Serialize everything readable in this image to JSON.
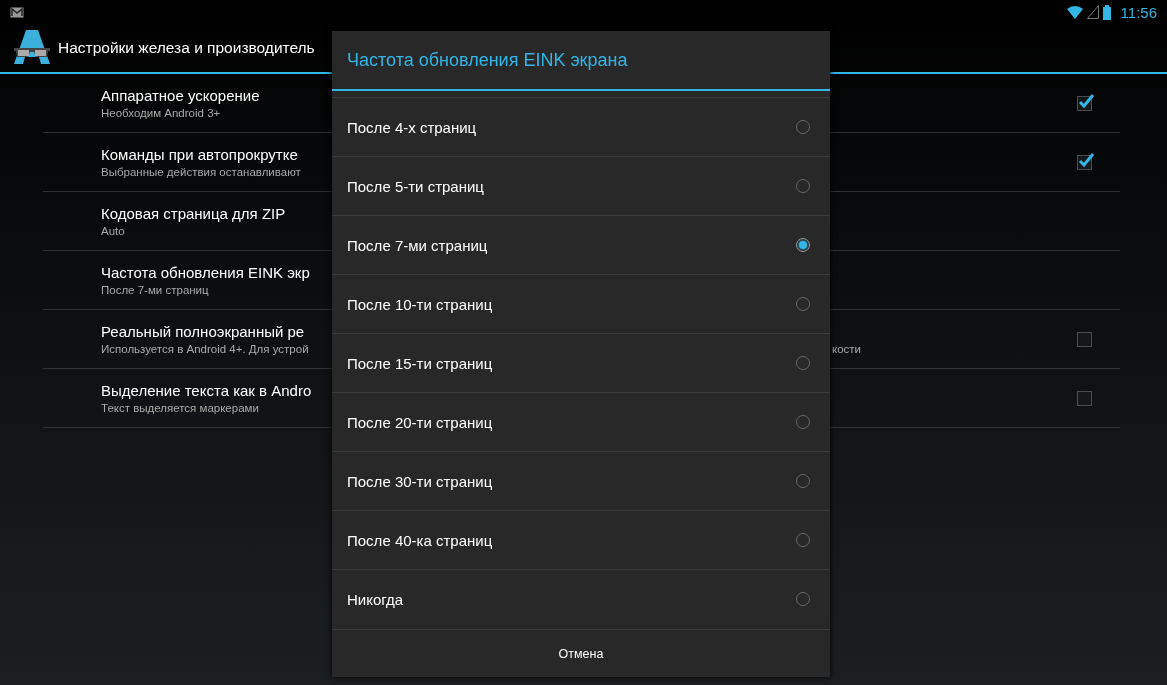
{
  "status_bar": {
    "time": "11:56"
  },
  "action_bar": {
    "title": "Настройки железа и производитель"
  },
  "preferences": [
    {
      "kind": "checkbox",
      "title": "Аппаратное ускорение",
      "summary": "Необходим Android 3+",
      "checked": true
    },
    {
      "kind": "checkbox",
      "title": "Команды при автопрокрутке",
      "summary": "Выбранные действия останавливают",
      "checked": true
    },
    {
      "kind": "plain",
      "title": "Кодовая страница для ZIP",
      "summary": "Auto"
    },
    {
      "kind": "plain",
      "title": "Частота обновления EINK экр",
      "summary": "После 7-ми страниц"
    },
    {
      "kind": "checkbox",
      "title": "Реальный полноэкранный ре",
      "summary": "Используется в Android 4+. Для устрой",
      "summary_end": "кости",
      "checked": false
    },
    {
      "kind": "checkbox",
      "title": "Выделение текста как в Andro",
      "summary": "Текст выделяется маркерами",
      "checked": false
    }
  ],
  "dialog": {
    "title": "Частота обновления EINK экрана",
    "options": [
      {
        "label": "После 4-х страниц",
        "selected": false
      },
      {
        "label": "После 5-ти страниц",
        "selected": false
      },
      {
        "label": "После 7-ми страниц",
        "selected": true
      },
      {
        "label": "После 10-ти страниц",
        "selected": false
      },
      {
        "label": "После 15-ти страниц",
        "selected": false
      },
      {
        "label": "После 20-ти страниц",
        "selected": false
      },
      {
        "label": "После 30-ти страниц",
        "selected": false
      },
      {
        "label": "После 40-ка страниц",
        "selected": false
      },
      {
        "label": "Никогда",
        "selected": false
      }
    ],
    "cancel": "Отмена"
  }
}
